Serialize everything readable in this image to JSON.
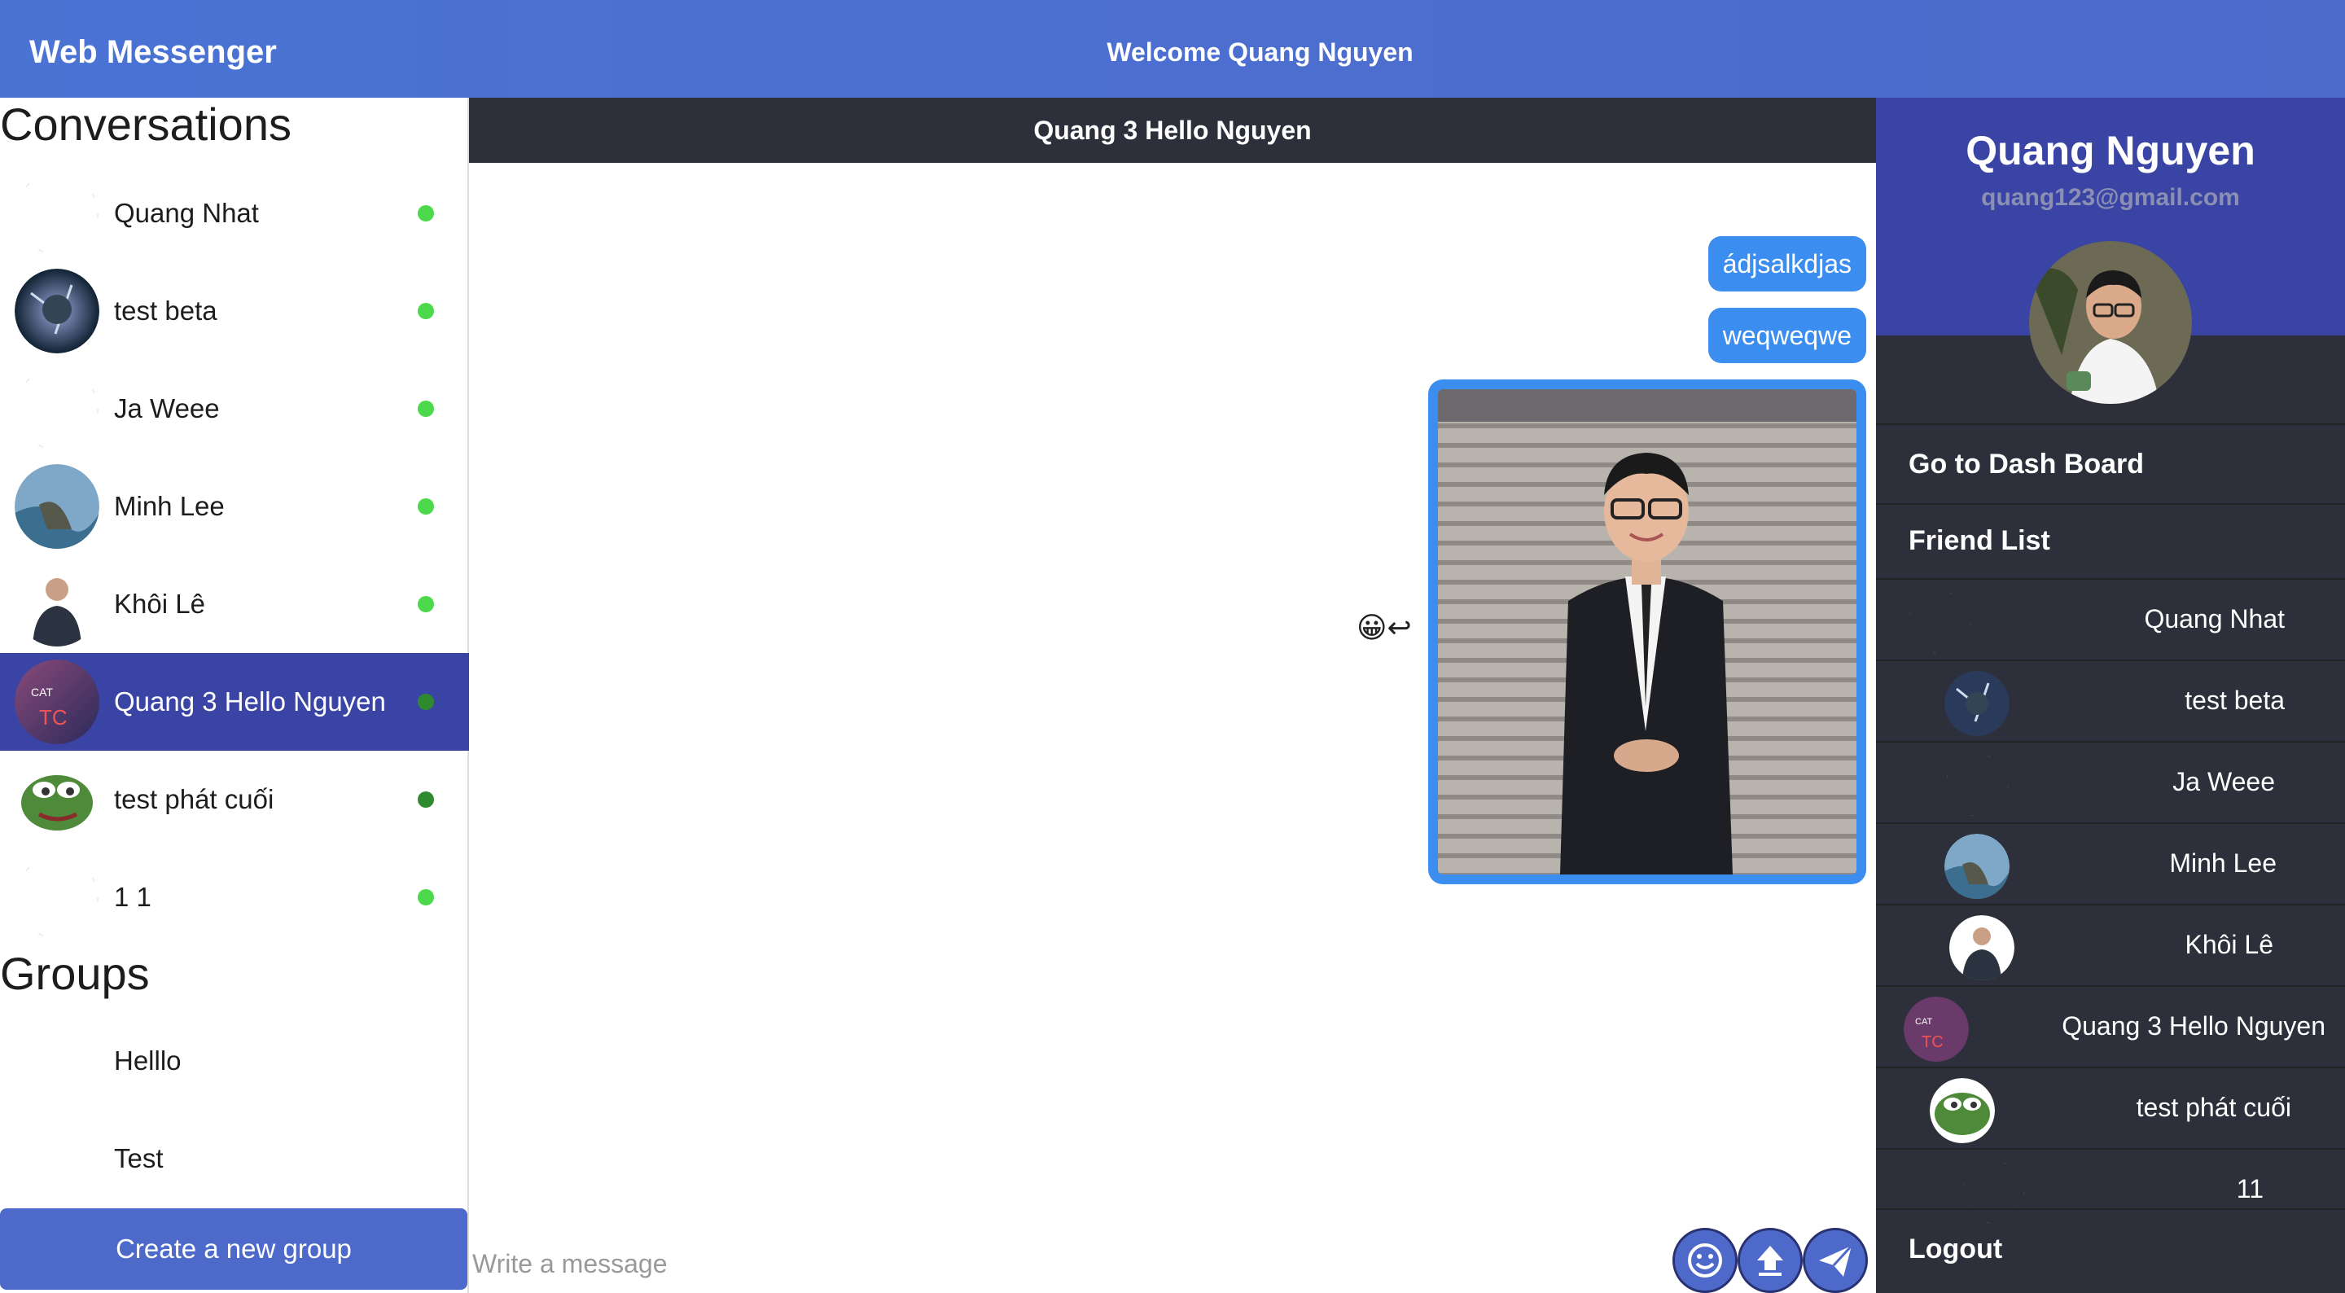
{
  "header": {
    "app_title": "Web Messenger",
    "welcome": "Welcome Quang Nguyen"
  },
  "conversations": {
    "heading": "Conversations",
    "items": [
      {
        "name": "Quang Nhat",
        "online": true
      },
      {
        "name": "test beta",
        "online": true
      },
      {
        "name": "Ja Weee",
        "online": true
      },
      {
        "name": "Minh Lee",
        "online": true
      },
      {
        "name": "Khôi Lê",
        "online": true
      },
      {
        "name": "Quang 3 Hello Nguyen",
        "online": true,
        "active": true
      },
      {
        "name": "test phát cuối",
        "online": true
      },
      {
        "name": "1 1",
        "online": true
      }
    ]
  },
  "groups": {
    "heading": "Groups",
    "items": [
      {
        "name": "Helllo"
      },
      {
        "name": "Test"
      }
    ],
    "create_label": "Create a new group"
  },
  "chat": {
    "title": "Quang 3 Hello Nguyen",
    "messages": [
      {
        "text": "ádjsalkdjas"
      },
      {
        "text": "weqweqwe"
      }
    ],
    "input_placeholder": "Write a message",
    "reactions": "😀↩"
  },
  "profile": {
    "name": "Quang Nguyen",
    "email": "quang123@gmail.com"
  },
  "menu": {
    "dashboard": "Go to Dash Board",
    "friend_list": "Friend List",
    "logout": "Logout"
  },
  "friends": [
    {
      "name": "Quang Nhat"
    },
    {
      "name": "test beta"
    },
    {
      "name": "Ja Weee"
    },
    {
      "name": "Minh Lee"
    },
    {
      "name": "Khôi Lê"
    },
    {
      "name": "Quang 3 Hello Nguyen"
    },
    {
      "name": "test phát cuối"
    },
    {
      "name": "11"
    }
  ],
  "colors": {
    "header": "#4a73d4",
    "active": "#3a44a4",
    "bubble": "#3b8ef0",
    "online": "#4cd94c",
    "sidebar": "#2d2f3a"
  }
}
